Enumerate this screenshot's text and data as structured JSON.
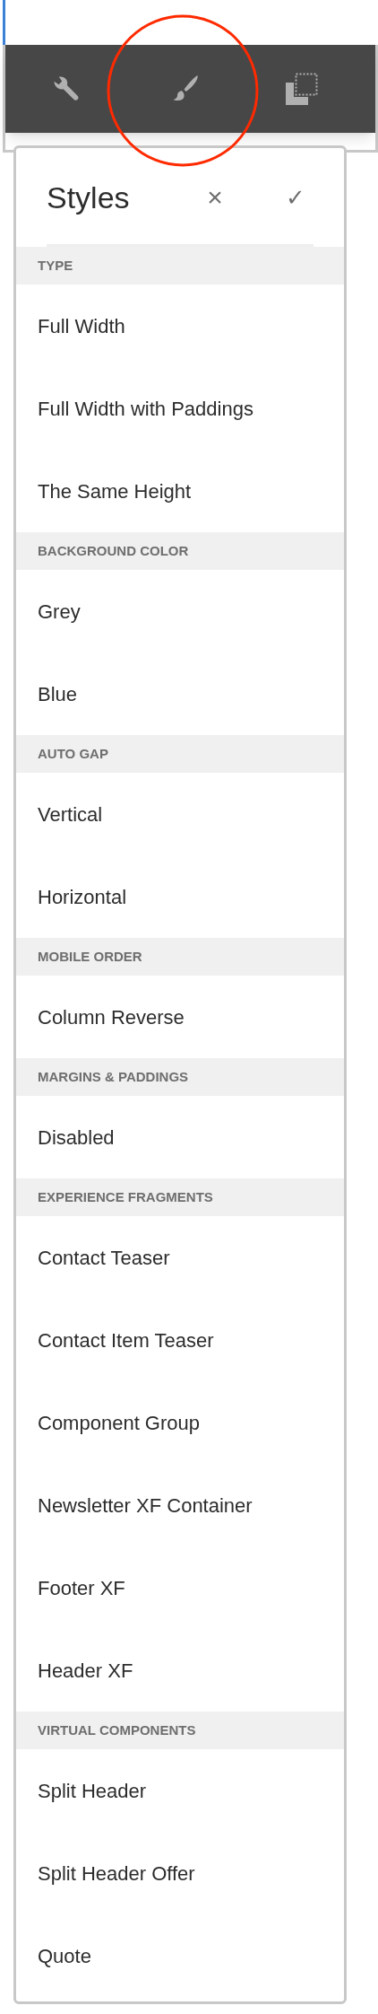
{
  "panel": {
    "title": "Styles",
    "close": "×",
    "confirm": "✓"
  },
  "sections": [
    {
      "heading": "TYPE",
      "items": [
        "Full Width",
        "Full Width with Paddings",
        "The Same Height"
      ]
    },
    {
      "heading": "BACKGROUND COLOR",
      "items": [
        "Grey",
        "Blue"
      ]
    },
    {
      "heading": "AUTO GAP",
      "items": [
        "Vertical",
        "Horizontal"
      ]
    },
    {
      "heading": "MOBILE ORDER",
      "items": [
        "Column Reverse"
      ]
    },
    {
      "heading": "MARGINS & PADDINGS",
      "items": [
        "Disabled"
      ]
    },
    {
      "heading": "EXPERIENCE FRAGMENTS",
      "items": [
        "Contact Teaser",
        "Contact Item Teaser",
        "Component Group",
        "Newsletter XF Container",
        "Footer XF",
        "Header XF"
      ]
    },
    {
      "heading": "VIRTUAL COMPONENTS",
      "items": [
        "Split Header",
        "Split Header Offer",
        "Quote"
      ]
    }
  ]
}
